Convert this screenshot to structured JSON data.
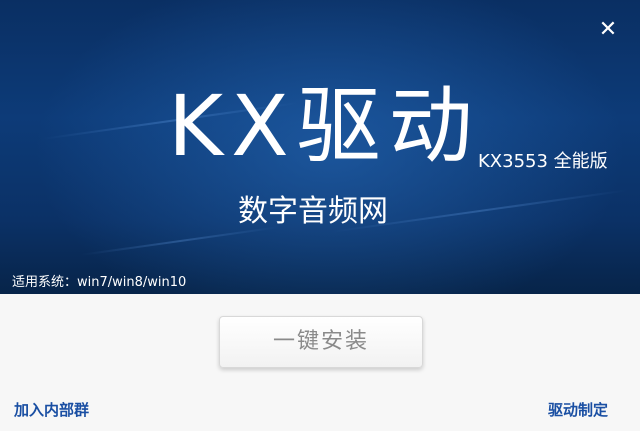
{
  "window": {
    "close_glyph": "✕",
    "close_icon": "close-icon"
  },
  "banner": {
    "title": "KX驱动",
    "version": "KX3553 全能版",
    "subtitle": "数字音频网",
    "os_support": "适用系统：win7/win8/win10"
  },
  "actions": {
    "install_label": "一键安装",
    "join_group_label": "加入内部群",
    "custom_driver_label": "驱动制定"
  },
  "colors": {
    "banner_dark": "#0a2f63",
    "banner_light": "#2e6fbf",
    "link": "#1a4fa3",
    "button_text": "#8a8a8a"
  }
}
